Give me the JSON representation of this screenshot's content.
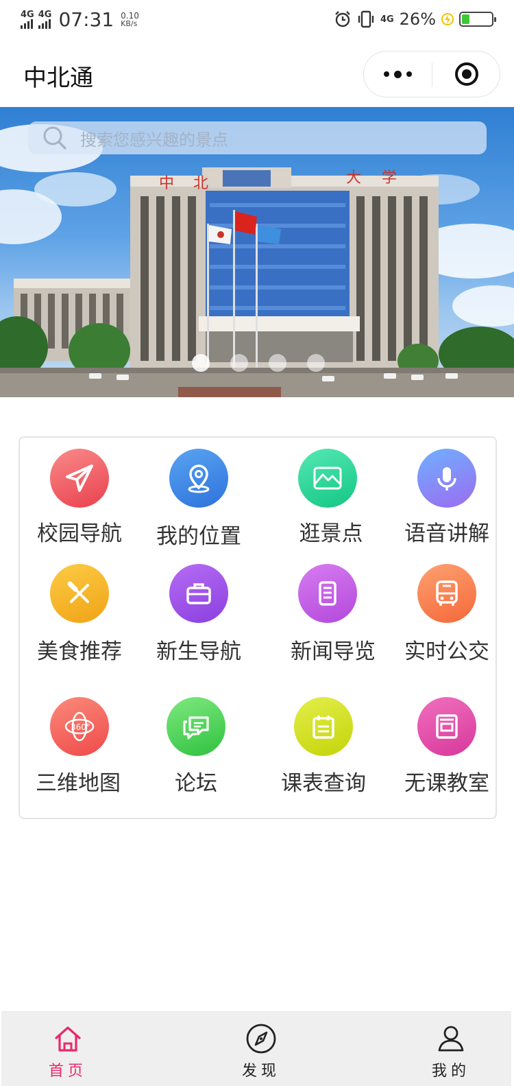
{
  "status_bar": {
    "network_1": "4G",
    "network_2": "4G",
    "time": "07:31",
    "speed_value": "0.10",
    "speed_unit": "KB/s",
    "network_3": "4G",
    "battery_percent": "26%",
    "battery_level": 0.26,
    "icons": [
      "alarm-icon",
      "vibrate-icon",
      "charging-icon",
      "battery-icon"
    ]
  },
  "nav": {
    "title": "中北通",
    "more_icon": "more-dots-icon",
    "close_icon": "target-circle-icon"
  },
  "banner": {
    "search_placeholder": "搜索您感兴趣的景点",
    "sign_chars": [
      "中",
      "北",
      "大",
      "学"
    ],
    "slide_count": 4,
    "active_slide": 0
  },
  "menu": {
    "items": [
      {
        "label": "校园导航",
        "icon": "paper-plane-icon",
        "color_from": "#f98a8a",
        "color_to": "#e9414d"
      },
      {
        "label": "我的位置",
        "icon": "location-pin-icon",
        "color_from": "#58a4f2",
        "color_to": "#2f72dc"
      },
      {
        "label": "逛景点",
        "icon": "mountain-scenery-icon",
        "color_from": "#55e8b3",
        "color_to": "#14c684"
      },
      {
        "label": "语音讲解",
        "icon": "microphone-icon",
        "color_from": "#6fb0ff",
        "color_to": "#9b6cf0"
      },
      {
        "label": "美食推荐",
        "icon": "utensils-icon",
        "color_from": "#fccb45",
        "color_to": "#f0a316"
      },
      {
        "label": "新生导航",
        "icon": "briefcase-icon",
        "color_from": "#b66cf3",
        "color_to": "#8b3fe0"
      },
      {
        "label": "新闻导览",
        "icon": "document-icon",
        "color_from": "#d67cf0",
        "color_to": "#b349dc"
      },
      {
        "label": "实时公交",
        "icon": "bus-icon",
        "color_from": "#fda170",
        "color_to": "#f5683a"
      },
      {
        "label": "三维地图",
        "icon": "360-view-icon",
        "color_from": "#fb8a7a",
        "color_to": "#ef4a4a"
      },
      {
        "label": "论坛",
        "icon": "chat-bubbles-icon",
        "color_from": "#7fe97f",
        "color_to": "#2fc13f"
      },
      {
        "label": "课表查询",
        "icon": "schedule-board-icon",
        "color_from": "#e3ee4a",
        "color_to": "#c4d40a"
      },
      {
        "label": "无课教室",
        "icon": "classroom-frame-icon",
        "color_from": "#f070bd",
        "color_to": "#d8379c"
      }
    ]
  },
  "tab_bar": {
    "tabs": [
      {
        "label": "首页",
        "icon": "home-icon",
        "active": true
      },
      {
        "label": "发现",
        "icon": "compass-icon",
        "active": false
      },
      {
        "label": "我的",
        "icon": "user-icon",
        "active": false
      }
    ],
    "active_color": "#ea2869"
  }
}
